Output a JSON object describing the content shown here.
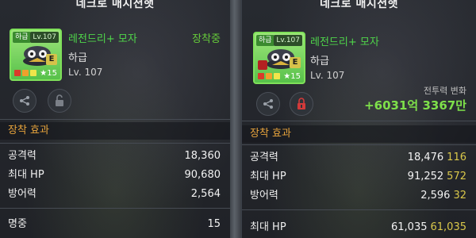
{
  "left": {
    "title": "네크로 매지션햇",
    "item": {
      "grade_tag": "하급",
      "level_tag": "Lv.107",
      "name": "레전드리+ 모자",
      "status": "장착중",
      "grade": "하급",
      "level": "Lv. 107",
      "star_count": "15",
      "badge": "E"
    },
    "section_label": "장착 효과",
    "stats": [
      {
        "name": "공격력",
        "value": "18,360"
      },
      {
        "name": "최대 HP",
        "value": "90,680"
      },
      {
        "name": "방어력",
        "value": "2,564"
      },
      {
        "name": "명중",
        "value": "15"
      }
    ]
  },
  "right": {
    "title": "네크로 매지션햇",
    "item": {
      "grade_tag": "하급",
      "level_tag": "Lv.107",
      "name": "레전드리+ 모자",
      "grade": "하급",
      "level": "Lv. 107",
      "star_count": "15",
      "badge": "E"
    },
    "power_label": "전투력 변화",
    "power_value": "+6031억 3367만",
    "section_label": "장착 효과",
    "stats": [
      {
        "name": "공격력",
        "value": "18,476",
        "bonus": "116"
      },
      {
        "name": "최대 HP",
        "value": "91,252",
        "bonus": "572"
      },
      {
        "name": "방어력",
        "value": "2,596",
        "bonus": "32"
      },
      {
        "name": "최대 HP",
        "value": "61,035",
        "bonus": "61,035"
      }
    ]
  },
  "colors": {
    "item_name": "#4fd64a",
    "equipped": "#66cc3a",
    "section": "#e7a33c",
    "bonus": "#d9c74a",
    "power": "#7ee04a",
    "lock_active": "#d23a3a"
  },
  "icons": {
    "share": "share-icon",
    "unlock": "unlock-icon",
    "lock": "lock-icon"
  }
}
